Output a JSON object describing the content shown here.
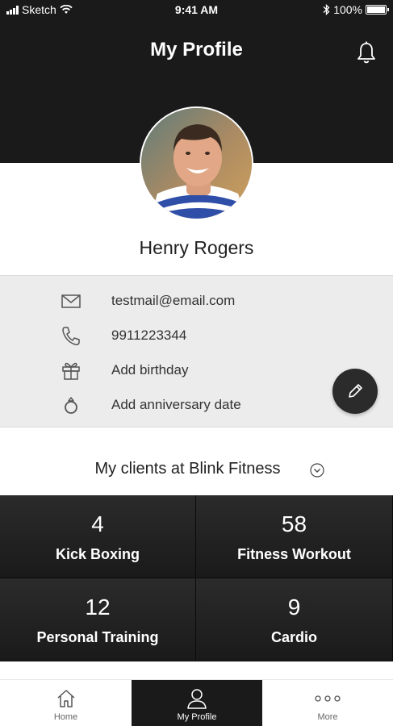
{
  "status_bar": {
    "carrier": "Sketch",
    "time": "9:41 AM",
    "battery": "100%"
  },
  "header": {
    "title": "My Profile"
  },
  "profile": {
    "name": "Henry Rogers",
    "email": "testmail@email.com",
    "phone": "9911223344",
    "birthday": "Add birthday",
    "anniversary": "Add anniversary date"
  },
  "clients": {
    "label": "My clients at Blink Fitness"
  },
  "stats": [
    {
      "count": "4",
      "label": "Kick Boxing"
    },
    {
      "count": "58",
      "label": "Fitness Workout"
    },
    {
      "count": "12",
      "label": "Personal Training"
    },
    {
      "count": "9",
      "label": "Cardio"
    }
  ],
  "tabs": {
    "home": "Home",
    "profile": "My Profile",
    "more": "More"
  },
  "colors": {
    "header_bg": "#1a1a1a",
    "info_bg": "#ececec",
    "stat_bg": "#222222",
    "active_tab_bg": "#1a1a1a"
  }
}
